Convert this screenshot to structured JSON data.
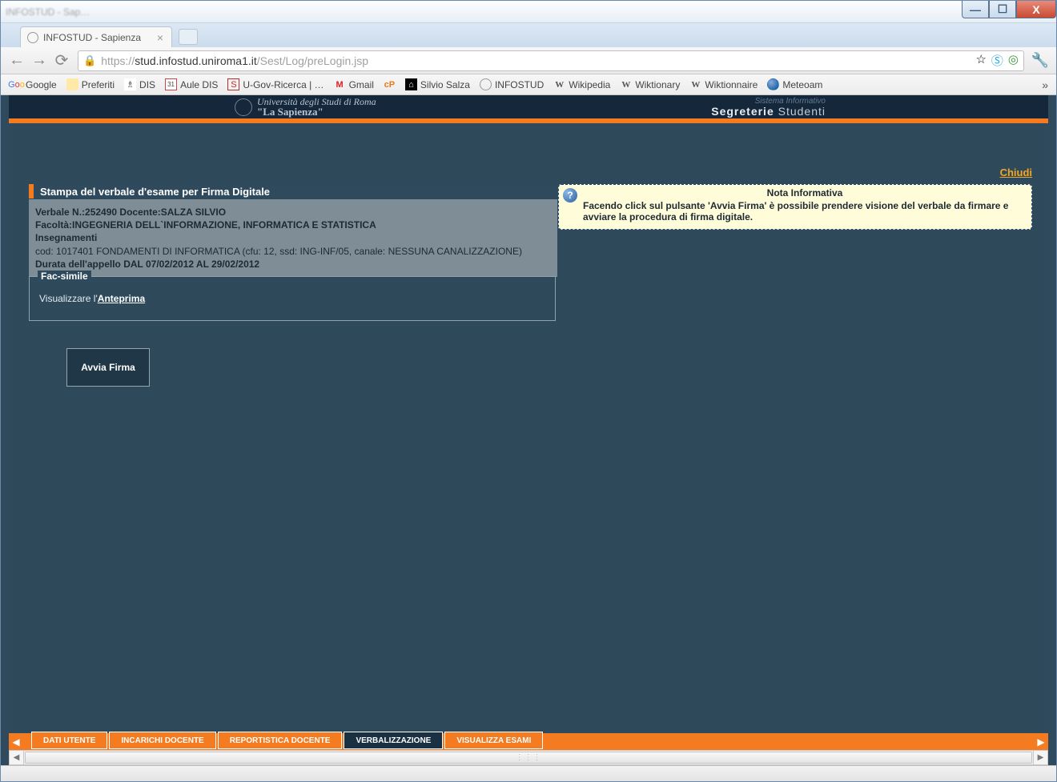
{
  "window": {
    "blur_title": "INFOSTUD - Sap…",
    "min": "—",
    "max": "☐",
    "close": "X"
  },
  "tab": {
    "title": "INFOSTUD - Sapienza",
    "close": "×"
  },
  "toolbar": {
    "back": "←",
    "fwd": "→",
    "reload": "⟳",
    "url_proto": "https://",
    "url_domain": "stud.infostud.uniroma1.it",
    "url_path": "/Sest/Log/preLogin.jsp",
    "star": "☆",
    "wrench": "🔧"
  },
  "bookmarks": {
    "items": [
      {
        "label": "Google",
        "type": "g"
      },
      {
        "label": "Preferiti",
        "type": "folder"
      },
      {
        "label": "DIS",
        "type": "dis"
      },
      {
        "label": "Aule DIS",
        "type": "cal"
      },
      {
        "label": "U-Gov-Ricerca | …",
        "type": "box"
      },
      {
        "label": "Gmail",
        "type": "gmail"
      },
      {
        "label": "",
        "type": "cp"
      },
      {
        "label": "Silvio Salza",
        "type": "wifi"
      },
      {
        "label": "INFOSTUD",
        "type": "globe"
      },
      {
        "label": "Wikipedia",
        "type": "wiki"
      },
      {
        "label": "Wiktionary",
        "type": "wiki"
      },
      {
        "label": "Wiktionnaire",
        "type": "wiki"
      },
      {
        "label": "Meteoam",
        "type": "meteo"
      }
    ],
    "overflow": "»"
  },
  "header": {
    "uni_row1": "Università degli Studi di Roma",
    "uni_row2": "\"La Sapienza\"",
    "sis_row1": "Sistema Informativo",
    "sis_row2a": "Segreterie",
    "sis_row2b": "Studenti"
  },
  "page": {
    "close_link": "Chiudi",
    "section_title": "Stampa del verbale d'esame per Firma Digitale",
    "info": {
      "line1a": "Verbale N.:252490 Docente:SALZA SILVIO",
      "line2a": "Facoltà:INGEGNERIA DELL`INFORMAZIONE, INFORMATICA E STATISTICA",
      "line3": "Insegnamenti",
      "line4": "cod: 1017401 FONDAMENTI DI INFORMATICA (cfu: 12, ssd: ING-INF/05, canale: NESSUNA CANALIZZAZIONE)",
      "line5": "Durata dell'appello DAL 07/02/2012 AL 29/02/2012"
    },
    "fac": {
      "legend": "Fac-simile",
      "text_pre": "Visualizzare l'",
      "link": "Anteprima"
    },
    "avvia": "Avvia Firma",
    "nota": {
      "title": "Nota Informativa",
      "body": "Facendo click sul pulsante 'Avvia Firma' è possibile prendere visione del verbale da firmare e avviare la procedura di firma digitale.",
      "q": "?"
    }
  },
  "bottom_tabs": {
    "left": "◀",
    "right": "▶",
    "items": [
      {
        "label": "DATI UTENTE",
        "active": false
      },
      {
        "label": "INCARICHI DOCENTE",
        "active": false
      },
      {
        "label": "REPORTISTICA DOCENTE",
        "active": false
      },
      {
        "label": "VERBALIZZAZIONE",
        "active": true
      },
      {
        "label": "VISUALIZZA ESAMI",
        "active": false
      }
    ]
  },
  "scroll": {
    "left": "◀",
    "right": "▶",
    "thumb": "⋮⋮⋮"
  }
}
